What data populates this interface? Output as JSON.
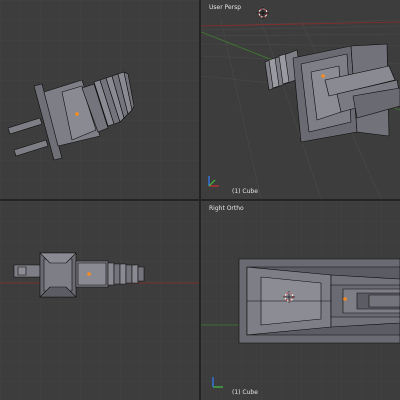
{
  "viewports": {
    "top_left": {
      "label": "",
      "object": ""
    },
    "top_right": {
      "label": "User Persp",
      "object": "(1) Cube"
    },
    "bottom_left": {
      "label": "",
      "object": ""
    },
    "bottom_right": {
      "label": "Right Ortho",
      "object": "(1) Cube"
    }
  },
  "colors": {
    "background": "#3d3d3d",
    "grid_minor": "#464646",
    "grid_major": "#4e4e4e",
    "mesh_face": "#7e7e86",
    "mesh_face_dark": "#5c5c64",
    "mesh_edge": "#0a0a0a",
    "x_axis": "#8a2a2a",
    "y_axis": "#3f7f2f",
    "origin": "#ff8c1a",
    "divider": "#232323"
  },
  "icons": [
    "axis-gizmo-icon",
    "3d-cursor-icon",
    "object-origin-icon"
  ]
}
